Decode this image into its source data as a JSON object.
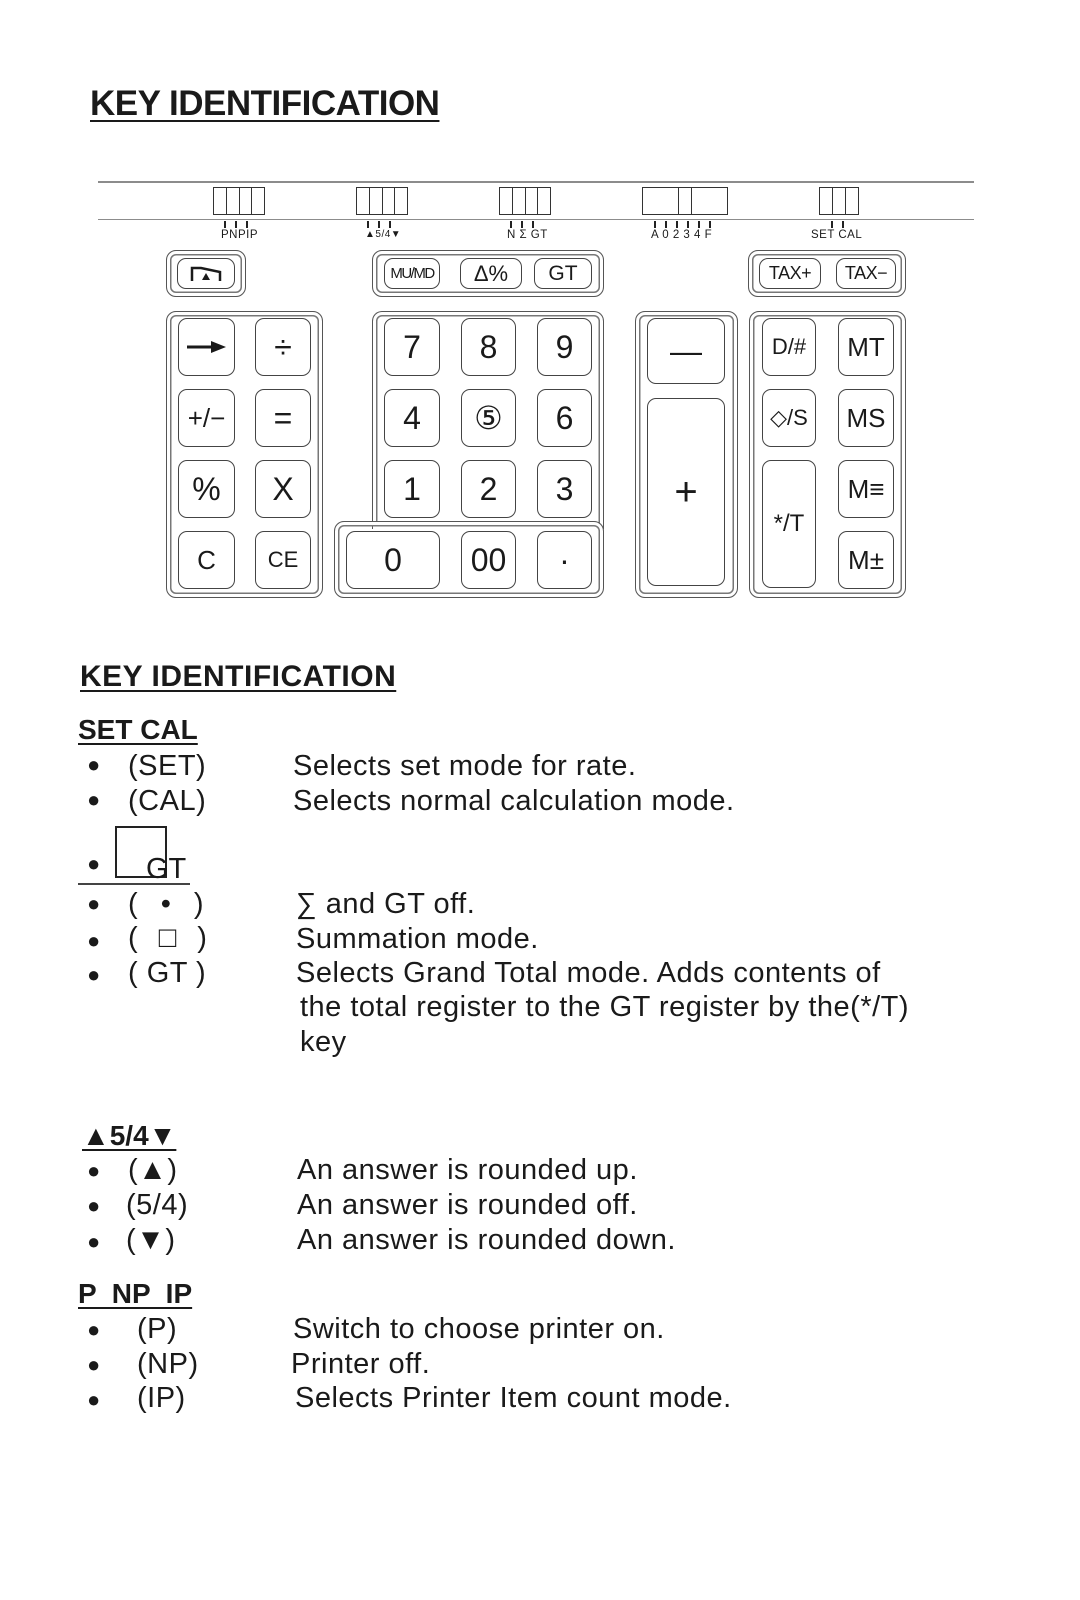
{
  "page_title": "KEY IDENTIFICATION",
  "switches": [
    {
      "name": "print-mode",
      "label": "PNPIP",
      "positions": [
        "P",
        "NP",
        "IP"
      ]
    },
    {
      "name": "rounding",
      "label": "▲5/4▼",
      "positions": [
        "▲",
        "5/4",
        "▼"
      ]
    },
    {
      "name": "gt-mode",
      "label": "N Σ GT",
      "positions": [
        "N",
        "Σ",
        "GT"
      ]
    },
    {
      "name": "decimal",
      "label": "A 0 2 3 4 F",
      "positions": [
        "A",
        "0",
        "2",
        "3",
        "4",
        "F"
      ]
    },
    {
      "name": "set-cal",
      "label": "SET CAL",
      "positions": [
        "SET",
        "CAL"
      ]
    }
  ],
  "keys": {
    "paper_feed": "⌐▲¬",
    "mu_md": "MU/MD",
    "delta_pct": "Δ%",
    "gt": "GT",
    "tax_plus": "TAX+",
    "tax_minus": "TAX−",
    "backspace": "➞",
    "divide": "÷",
    "sign": "+/−",
    "equals": "=",
    "percent": "%",
    "multiply": "X",
    "clear": "C",
    "clear_entry": "CE",
    "n7": "7",
    "n8": "8",
    "n9": "9",
    "n4": "4",
    "n5": "⑤",
    "n6": "6",
    "n1": "1",
    "n2": "2",
    "n3": "3",
    "n0": "0",
    "n00": "00",
    "decimal": "·",
    "minus": "—",
    "plus": "+",
    "date_num": "D/#",
    "mt": "MT",
    "nonadd_sub": "◇/S",
    "ms": "MS",
    "total": "*/T",
    "m_eq": "M≡",
    "m_pm": "M±"
  },
  "section_title": "KEY IDENTIFICATION",
  "sections": {
    "set_cal": {
      "title": "SET CAL",
      "items": [
        {
          "key": "(SET)",
          "desc": "Selects set mode for rate."
        },
        {
          "key": "(CAL)",
          "desc": "Selects normal calculation mode."
        }
      ]
    },
    "gt": {
      "title": "GT",
      "items": [
        {
          "key": "( • )",
          "desc": "∑ and GT off."
        },
        {
          "key": "( □ )",
          "desc": "Summation mode."
        },
        {
          "key": "( GT )",
          "desc_lines": [
            "Selects Grand Total mode. Adds contents of",
            "the total register to the GT register by the(*/T)",
            "key"
          ]
        }
      ]
    },
    "rounding": {
      "title": "▲5/4▼",
      "items": [
        {
          "key": "(▲)",
          "desc": "An answer is rounded up."
        },
        {
          "key": "(5/4)",
          "desc": "An answer is rounded off."
        },
        {
          "key": "(▼)",
          "desc": "An answer is rounded down."
        }
      ]
    },
    "printer": {
      "title": "P  NP  IP",
      "items": [
        {
          "key": "(P)",
          "desc": "Switch to choose printer on."
        },
        {
          "key": "(NP)",
          "desc": "Printer off."
        },
        {
          "key": "(IP)",
          "desc": "Selects Printer Item count mode."
        }
      ]
    }
  }
}
